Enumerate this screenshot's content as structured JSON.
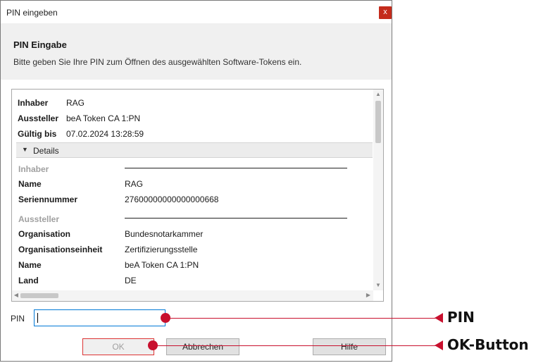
{
  "window": {
    "title": "PIN eingeben",
    "close_glyph": "x"
  },
  "header": {
    "title": "PIN Eingabe",
    "description": "Bitte geben Sie Ihre PIN zum Öffnen des ausgewählten Software-Tokens ein."
  },
  "summary": [
    {
      "label": "Inhaber",
      "value": "RAG"
    },
    {
      "label": "Aussteller",
      "value": "beA Token CA 1:PN"
    },
    {
      "label": "Gültig bis",
      "value": "07.02.2024 13:28:59"
    }
  ],
  "details": {
    "toggle_label": "Details",
    "holder_section": "Inhaber",
    "holder_rows": [
      {
        "label": "Name",
        "value": "RAG"
      },
      {
        "label": "Seriennummer",
        "value": "27600000000000000668"
      }
    ],
    "issuer_section": "Aussteller",
    "issuer_rows": [
      {
        "label": "Organisation",
        "value": "Bundesnotarkammer"
      },
      {
        "label": "Organisationseinheit",
        "value": "Zertifizierungsstelle"
      },
      {
        "label": "Name",
        "value": "beA Token CA 1:PN"
      },
      {
        "label": "Land",
        "value": "DE"
      }
    ]
  },
  "pin": {
    "label": "PIN",
    "value": ""
  },
  "buttons": {
    "ok": "OK",
    "cancel": "Abbrechen",
    "help": "Hilfe"
  },
  "annotations": {
    "pin": "PIN",
    "ok": "OK-Button"
  },
  "colors": {
    "accent": "#c8102e",
    "close": "#c42b1c",
    "focus": "#0078d7"
  }
}
